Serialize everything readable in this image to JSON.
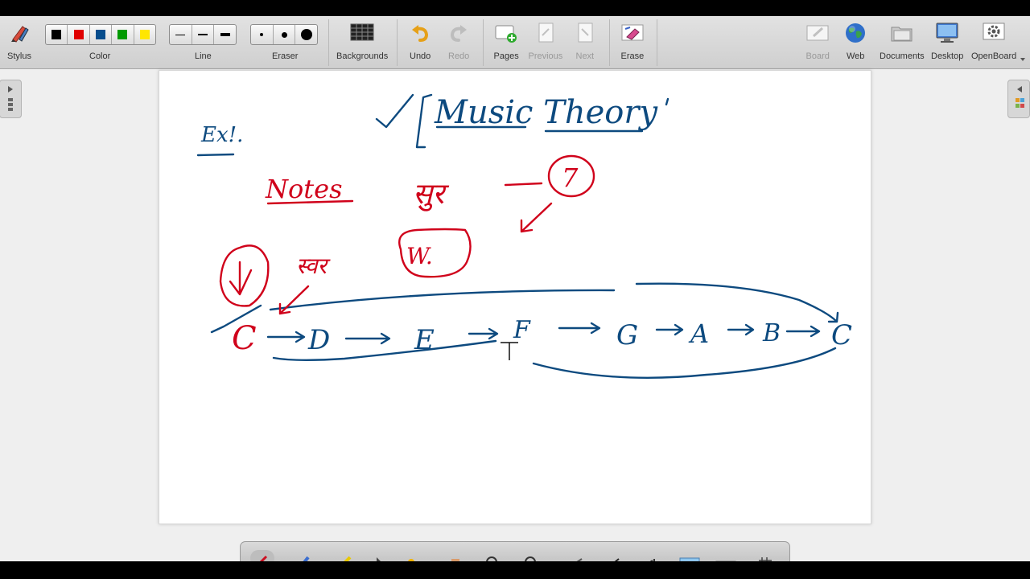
{
  "toolbar": {
    "stylus": "Stylus",
    "color": "Color",
    "line": "Line",
    "eraser": "Eraser",
    "backgrounds": "Backgrounds",
    "undo": "Undo",
    "redo": "Redo",
    "pages": "Pages",
    "previous": "Previous",
    "next": "Next",
    "erase": "Erase",
    "board": "Board",
    "web": "Web",
    "documents": "Documents",
    "desktop": "Desktop",
    "openboard": "OpenBoard"
  },
  "colors": {
    "swatches": [
      "#000000",
      "#e00000",
      "#064d8d",
      "#009a00",
      "#ffe600"
    ],
    "ink_blue": "#0d4a7f",
    "ink_red": "#d0021b"
  },
  "whiteboard": {
    "title": "Music Theory",
    "example_label": "Ex!.",
    "notes_label": "Notes",
    "hindi_label": "सुर",
    "count": "7",
    "w_label": "W.",
    "hindi_small": "स्वर",
    "scale": [
      "C",
      "D",
      "E",
      "F",
      "G",
      "A",
      "B",
      "C"
    ]
  },
  "dock_icons": [
    "pen-icon",
    "marker-icon",
    "highlighter-icon",
    "pointer-icon",
    "laser-icon",
    "hand-icon",
    "zoom-in-icon",
    "zoom-out-icon",
    "line-icon",
    "text-icon",
    "capture-icon",
    "keyboard-icon",
    "grid-icon"
  ]
}
